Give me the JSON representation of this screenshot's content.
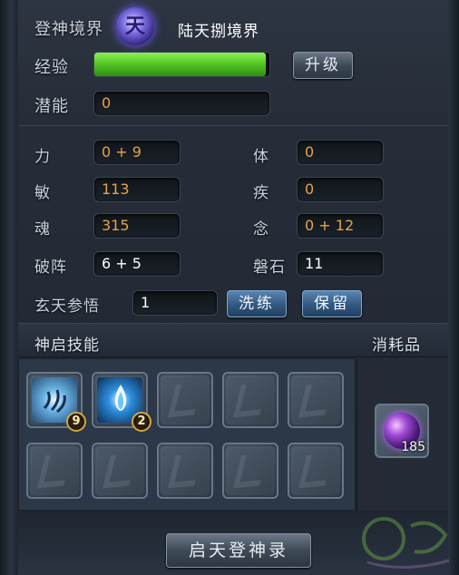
{
  "realm": {
    "label": "登神境界",
    "badge_char": "天",
    "name": "陆天捌境界"
  },
  "experience": {
    "label": "经验",
    "progress": 0.98,
    "upgrade_button": "升级"
  },
  "potential": {
    "label": "潜能",
    "value": "0"
  },
  "stats": [
    {
      "label": "力",
      "value": "0 + 9"
    },
    {
      "label": "体",
      "value": "0"
    },
    {
      "label": "敏",
      "value": "113"
    },
    {
      "label": "疾",
      "value": "0"
    },
    {
      "label": "魂",
      "value": "315"
    },
    {
      "label": "念",
      "value": "0 + 12"
    },
    {
      "label": "破阵",
      "value": "6 + 5"
    },
    {
      "label": "磐石",
      "value": "11"
    }
  ],
  "xuantian": {
    "label": "玄天参悟",
    "value": "1",
    "refine_button": "洗练",
    "keep_button": "保留"
  },
  "skills": {
    "header": "神启技能",
    "slots": [
      {
        "icon": "wind-claw-skill-icon",
        "level": "9"
      },
      {
        "icon": "blue-flame-skill-icon",
        "level": "2"
      }
    ]
  },
  "consumables": {
    "header": "消耗品",
    "item": {
      "icon": "purple-orb-icon",
      "count": "185"
    }
  },
  "footer": {
    "button": "启天登神录"
  },
  "colors": {
    "exp_green": "#4fc421",
    "value_orange": "#e8a24a",
    "accent_blue": "#355b86"
  }
}
